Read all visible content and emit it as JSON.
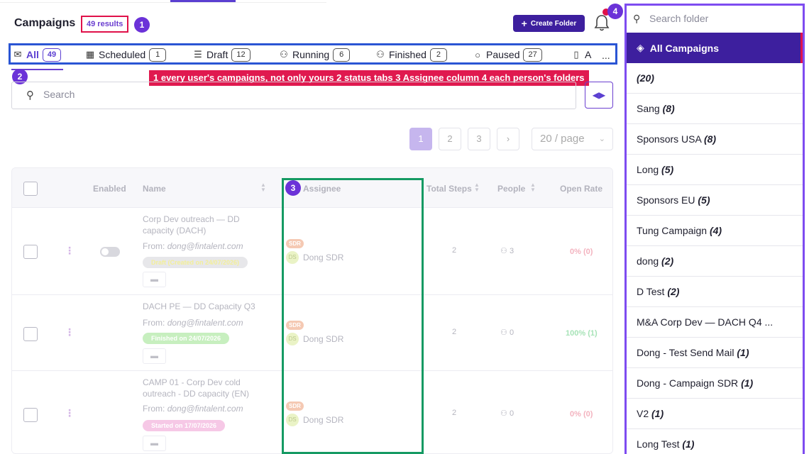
{
  "header": {
    "title": "Campaigns",
    "results": "49 results",
    "create_folder": "Create Folder",
    "notification_badge": "4"
  },
  "markers": [
    "1",
    "2",
    "3",
    "4"
  ],
  "legend": "1 every user's campaigns, not only yours   2 status tabs   3 Assignee column   4 each person's folders",
  "tabs": [
    {
      "label": "All",
      "count": "49",
      "icon": "envelope-icon",
      "active": true
    },
    {
      "label": "Scheduled",
      "count": "1",
      "icon": "calendar-clock-icon"
    },
    {
      "label": "Draft",
      "count": "12",
      "icon": "list-icon"
    },
    {
      "label": "Running",
      "count": "6",
      "icon": "users-icon"
    },
    {
      "label": "Finished",
      "count": "2",
      "icon": "users-icon"
    },
    {
      "label": "Paused",
      "count": "27",
      "icon": "search-icon"
    },
    {
      "label": "A",
      "icon": "document-icon"
    }
  ],
  "tabs_more": "...",
  "search": {
    "placeholder": "Search"
  },
  "pagination": {
    "pages": [
      "1",
      "2",
      "3"
    ],
    "current": "1",
    "per_page": "20 / page"
  },
  "table": {
    "columns": [
      "Enabled",
      "Name",
      "Assignee",
      "Total Steps",
      "People",
      "Open Rate"
    ],
    "rows": [
      {
        "name": "Corp Dev outreach — DD capacity (DACH)",
        "from_label": "From:",
        "from_email": "dong@fintalent.com",
        "status": "Draft (Created on 24/07/2026)",
        "status_kind": "draft",
        "role": "SDR",
        "initials": "DS",
        "assignee": "Dong SDR",
        "total_steps": "2",
        "people": "3",
        "open_rate": "0% (0)",
        "has_switch": true
      },
      {
        "name": "DACH PE — DD Capacity Q3",
        "from_label": "From:",
        "from_email": "dong@fintalent.com",
        "status": "Finished on 24/07/2026",
        "status_kind": "finished",
        "role": "SDR",
        "initials": "DS",
        "assignee": "Dong SDR",
        "total_steps": "2",
        "people": "0",
        "open_rate": "100% (1)",
        "has_switch": false
      },
      {
        "name": "CAMP 01 - Corp Dev cold outreach - DD capacity (EN)",
        "from_label": "From:",
        "from_email": "dong@fintalent.com",
        "status": "Started on 17/07/2026",
        "status_kind": "started",
        "role": "SDR",
        "initials": "DS",
        "assignee": "Dong SDR",
        "total_steps": "2",
        "people": "0",
        "open_rate": "0% (0)",
        "has_switch": false
      }
    ]
  },
  "folders_panel": {
    "search_placeholder": "Search folder",
    "all_label": "All Campaigns",
    "folders": [
      {
        "name": "",
        "count": "(20)"
      },
      {
        "name": "Sang",
        "count": "(8)"
      },
      {
        "name": "Sponsors USA",
        "count": "(8)"
      },
      {
        "name": "Long",
        "count": "(5)"
      },
      {
        "name": "Sponsors EU",
        "count": "(5)"
      },
      {
        "name": "Tung Campaign",
        "count": "(4)"
      },
      {
        "name": "dong",
        "count": "(2)"
      },
      {
        "name": "D Test",
        "count": "(2)"
      },
      {
        "name": "M&A Corp Dev — DACH Q4 ...",
        "count": ""
      },
      {
        "name": "Dong - Test Send Mail",
        "count": "(1)"
      },
      {
        "name": "Dong - Campaign SDR",
        "count": "(1)"
      },
      {
        "name": "V2",
        "count": "(1)"
      },
      {
        "name": "Long Test",
        "count": "(1)"
      }
    ]
  },
  "colors": {
    "accent": "#3d1f9e",
    "annotation_red": "#e0114a",
    "tabs_box": "#2a55d4",
    "assignee_box": "#159a63",
    "panel_box": "#7e4cf0"
  }
}
